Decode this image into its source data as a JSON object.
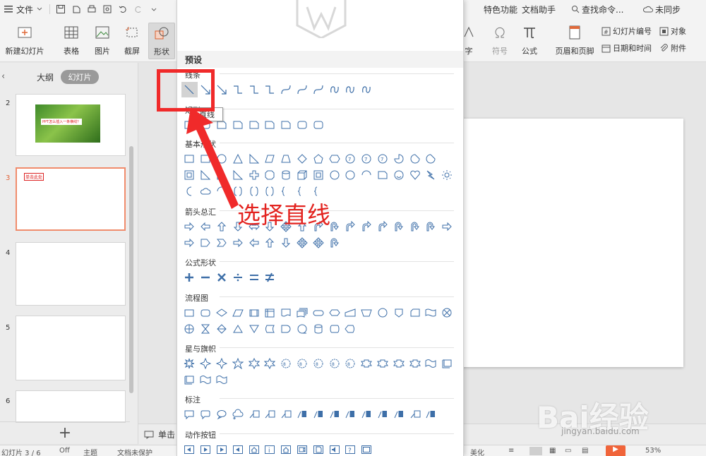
{
  "menu": {
    "file": "文件",
    "right_tabs": [
      "特色功能",
      "文档助手"
    ],
    "search": "查找命令...",
    "sync": "未同步"
  },
  "ribbon": {
    "new_slide": "新建幻灯片",
    "table": "表格",
    "picture": "图片",
    "screenshot": "截屏",
    "shape": "形状",
    "word_art": "字",
    "symbol": "符号",
    "formula": "公式",
    "header_footer": "页眉和页脚",
    "slide_number": "幻灯片编号",
    "object": "对象",
    "datetime": "日期和时间",
    "attachment": "附件"
  },
  "left_panel": {
    "outline_tab": "大纲",
    "slides_tab": "幻灯片",
    "collapse_icon": "chevron-left-icon",
    "slide_numbers": [
      "2",
      "3",
      "4",
      "5",
      "6"
    ],
    "slide2_caption": "PPT怎么插入一条横线？",
    "slide3_caption": "单击此处"
  },
  "notes": {
    "label": "单击"
  },
  "statusbar": {
    "slide_info": "幻灯片 3 / 6",
    "office": "Off",
    "theme": "主题",
    "protect": "文档未保护",
    "beautify": "美化",
    "zoom": "53%"
  },
  "shape_panel": {
    "preset": "预设",
    "categories": {
      "lines": "线条",
      "rect": "矩形",
      "basic": "基本形状",
      "arrows": "箭头总汇",
      "formula": "公式形状",
      "flowchart": "流程图",
      "stars": "星与旗帜",
      "callouts": "标注",
      "actions": "动作按钮"
    },
    "tooltip": "直线"
  },
  "annotation": {
    "text": "选择直线"
  },
  "watermark": {
    "brand": "Bai经验",
    "url": "jingyan.baidu.com"
  },
  "colors": {
    "accent_red": "#f02a2a",
    "shape_blue": "#3e6fa8",
    "selected_border": "#f08c6c"
  }
}
